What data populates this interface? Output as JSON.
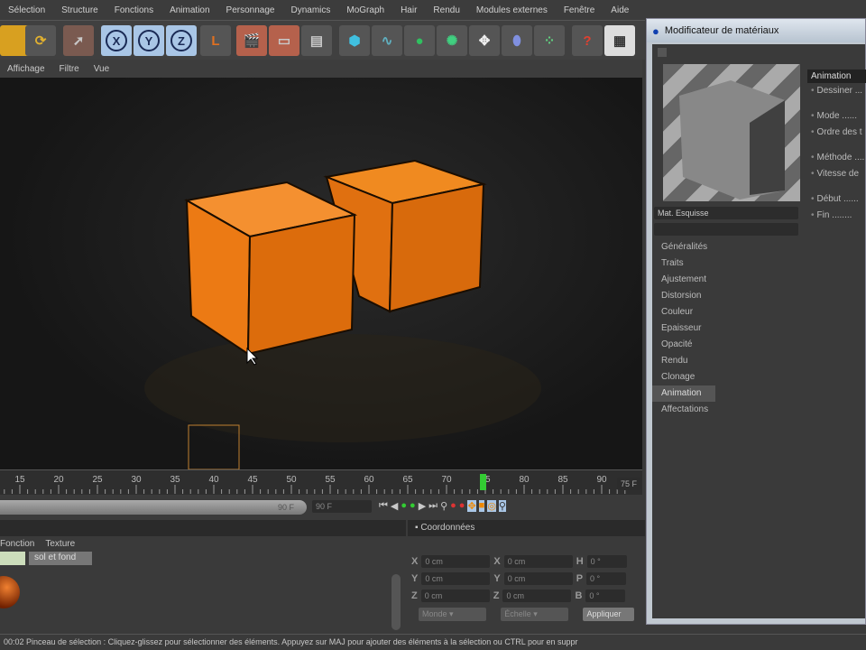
{
  "menu": [
    "Sélection",
    "Structure",
    "Fonctions",
    "Animation",
    "Personnage",
    "Dynamics",
    "MoGraph",
    "Hair",
    "Rendu",
    "Modules externes",
    "Fenêtre",
    "Aide"
  ],
  "toolbar": {
    "x": "X",
    "y": "Y",
    "z": "Z"
  },
  "viewport_menu": [
    "Affichage",
    "Filtre",
    "Vue"
  ],
  "timeline": {
    "ticks": [
      15,
      20,
      25,
      30,
      35,
      40,
      45,
      50,
      55,
      60,
      65,
      70,
      75,
      80,
      85,
      90
    ],
    "current_frame": 75,
    "current_label": "75 F",
    "end_label": "90 F",
    "field": "90 F"
  },
  "materials": {
    "tabs": [
      "Fonction",
      "Texture"
    ],
    "material_name": "sol et fond"
  },
  "coords": {
    "title": "Coordonnées",
    "rows": [
      {
        "a": "X",
        "v1": "0 cm",
        "b": "X",
        "v2": "0 cm",
        "c": "H",
        "v3": "0 °"
      },
      {
        "a": "Y",
        "v1": "0 cm",
        "b": "Y",
        "v2": "0 cm",
        "c": "P",
        "v3": "0 °"
      },
      {
        "a": "Z",
        "v1": "0 cm",
        "b": "Z",
        "v2": "0 cm",
        "c": "B",
        "v3": "0 °"
      }
    ],
    "mode": "Monde",
    "scale": "Échelle",
    "apply": "Appliquer"
  },
  "status": "00:02  Pinceau de sélection : Cliquez-glissez pour sélectionner des éléments. Appuyez sur MAJ pour ajouter des éléments à la sélection ou CTRL pour en suppr",
  "dialog": {
    "title": "Modificateur de matériaux",
    "material": "Mat. Esquisse",
    "list": [
      "Généralités",
      "Traits",
      "Ajustement",
      "Distorsion",
      "Couleur",
      "Epaisseur",
      "Opacité",
      "Rendu",
      "Clonage",
      "Animation",
      "Affectations"
    ],
    "selected": "Animation",
    "section": "Animation",
    "props": [
      "Dessiner ...",
      "Mode ......",
      "Ordre des t",
      "Méthode ....",
      "Vitesse de",
      "Début ......",
      "Fin ........"
    ]
  }
}
